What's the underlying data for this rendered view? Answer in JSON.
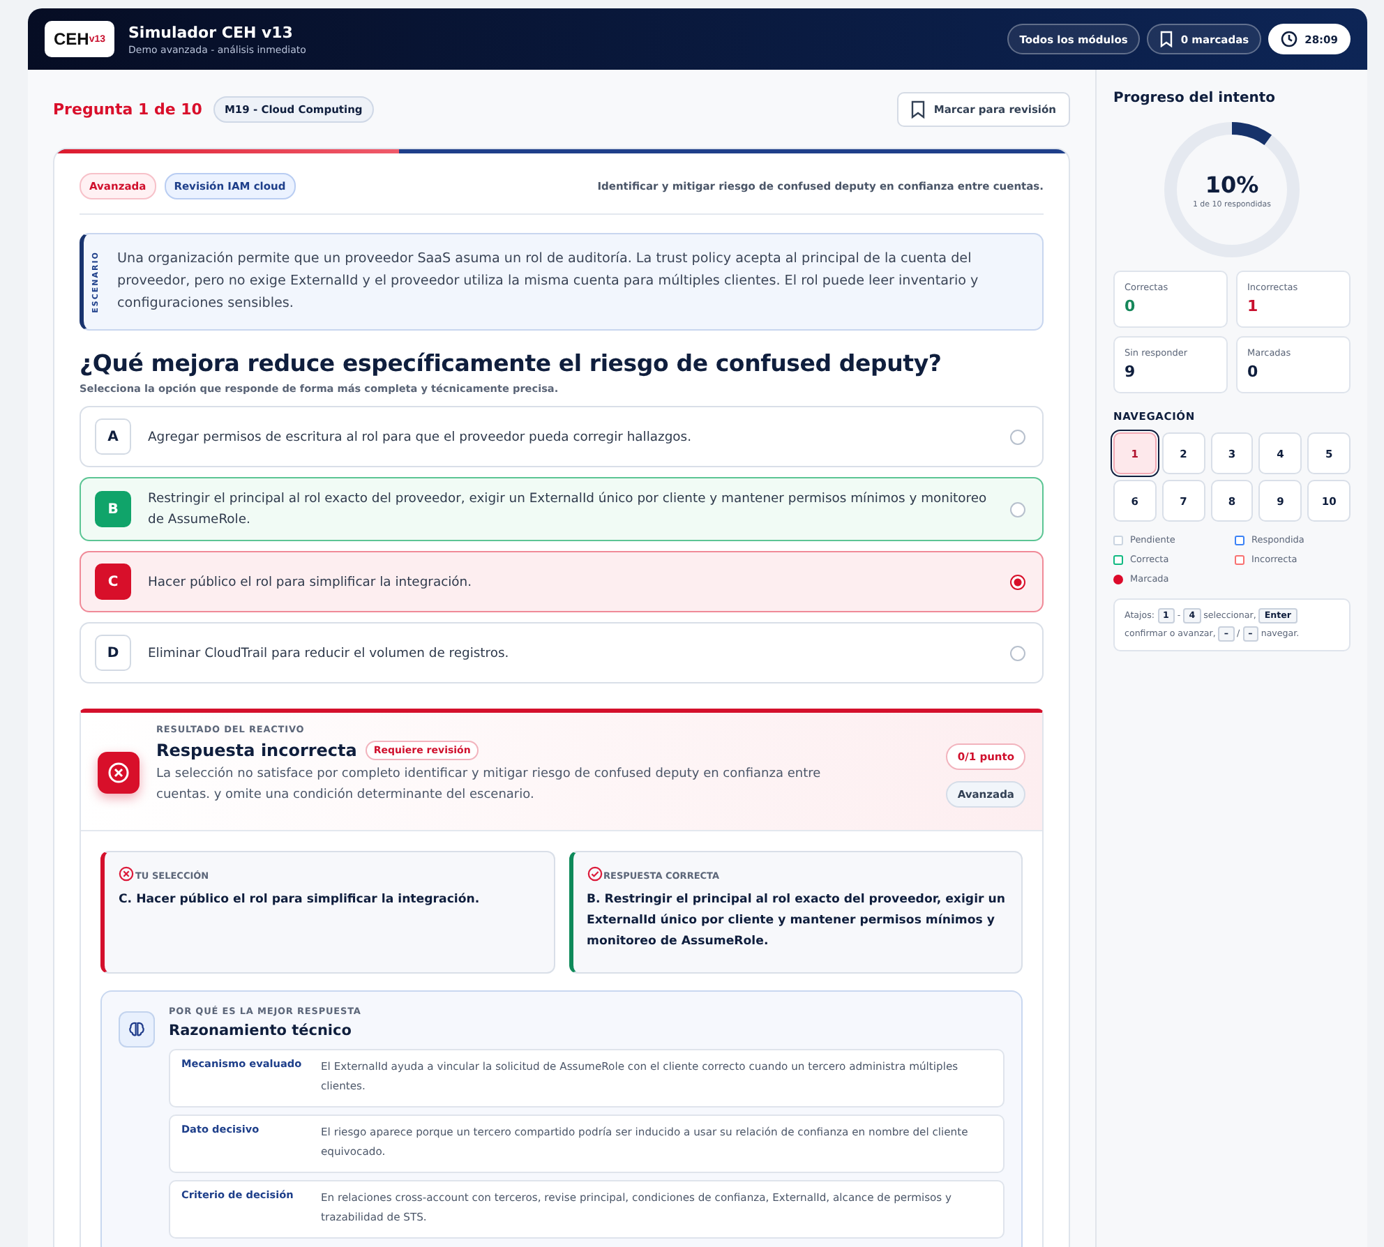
{
  "header": {
    "logo_main": "CEH",
    "logo_version": "v13",
    "title": "Simulador CEH v13",
    "subtitle": "Demo avanzada - análisis inmediato",
    "modules_button": "Todos los módulos",
    "marked_button": "0 marcadas",
    "timer": "28:09"
  },
  "question_bar": {
    "counter": "Pregunta 1 de 10",
    "module_tag": "M19 - Cloud Computing",
    "mark_button": "Marcar para revisión"
  },
  "question": {
    "level": 0.34,
    "tags": [
      {
        "label": "Avanzada",
        "kind": "danger"
      },
      {
        "label": "Revisión IAM cloud",
        "kind": "info"
      }
    ],
    "objective": "Identificar y mitigar riesgo de confused deputy en confianza entre cuentas.",
    "scenario_label": "ESCENARIO",
    "scenario": "Una organización permite que un proveedor SaaS asuma un rol de auditoría. La trust policy acepta al principal de la cuenta del proveedor, pero no exige ExternalId y el proveedor utiliza la misma cuenta para múltiples clientes. El rol puede leer inventario y configuraciones sensibles.",
    "prompt": "¿Qué mejora reduce específicamente el riesgo de confused deputy?",
    "hint": "Selecciona la opción que responde de forma más completa y técnicamente precisa.",
    "options": [
      {
        "letter": "A",
        "text": "Agregar permisos de escritura al rol para que el proveedor pueda corregir hallazgos.",
        "kind": "neutral",
        "selected": false
      },
      {
        "letter": "B",
        "text": "Restringir el principal al rol exacto del proveedor, exigir un ExternalId único por cliente y mantener permisos mínimos y monitoreo de AssumeRole.",
        "kind": "correct",
        "selected": false
      },
      {
        "letter": "C",
        "text": "Hacer público el rol para simplificar la integración.",
        "kind": "incorrect",
        "selected": true
      },
      {
        "letter": "D",
        "text": "Eliminar CloudTrail para reducir el volumen de registros.",
        "kind": "neutral",
        "selected": false
      }
    ]
  },
  "result": {
    "eyebrow": "RESULTADO DEL REACTIVO",
    "title": "Respuesta incorrecta",
    "badge": "Requiere revisión",
    "text": "La selección no satisface por completo identificar y mitigar riesgo de confused deputy en confianza entre cuentas. y omite una condición determinante del escenario.",
    "score": "0/1 punto",
    "difficulty": "Avanzada",
    "comparison": [
      {
        "kind": "wrong",
        "label": "TU SELECCIÓN",
        "text": "C. Hacer público el rol para simplificar la integración."
      },
      {
        "kind": "right",
        "label": "RESPUESTA CORRECTA",
        "text": "B. Restringir el principal al rol exacto del proveedor, exigir un ExternalId único por cliente y mantener permisos mínimos y monitoreo de AssumeRole."
      }
    ],
    "reasoning": {
      "eyebrow": "POR QUÉ ES LA MEJOR RESPUESTA",
      "title": "Razonamiento técnico",
      "rows": [
        {
          "label": "Mecanismo evaluado",
          "text": "El ExternalId ayuda a vincular la solicitud de AssumeRole con el cliente correcto cuando un tercero administra múltiples clientes."
        },
        {
          "label": "Dato decisivo",
          "text": "El riesgo aparece porque un tercero compartido podría ser inducido a usar su relación de confianza en nombre del cliente equivocado."
        },
        {
          "label": "Criterio de decisión",
          "text": "En relaciones cross-account con terceros, revise principal, condiciones de confianza, ExternalId, alcance de permisos y trazabilidad de STS."
        }
      ]
    }
  },
  "sidebar": {
    "title": "Progreso del intento",
    "percent": "10%",
    "level": 0.1,
    "answered": "1 de 10 respondidas",
    "stats": [
      {
        "label": "Correctas",
        "value": "0",
        "kind": "good"
      },
      {
        "label": "Incorrectas",
        "value": "1",
        "kind": "bad"
      },
      {
        "label": "Sin responder",
        "value": "9",
        "kind": "plain"
      },
      {
        "label": "Marcadas",
        "value": "0",
        "kind": "plain"
      }
    ],
    "nav_title": "NAVEGACIÓN",
    "nav": [
      {
        "label": "1",
        "selected": true,
        "kind": "incorrect"
      },
      {
        "label": "2",
        "selected": false,
        "kind": "pending"
      },
      {
        "label": "3",
        "selected": false,
        "kind": "pending"
      },
      {
        "label": "4",
        "selected": false,
        "kind": "pending"
      },
      {
        "label": "5",
        "selected": false,
        "kind": "pending"
      },
      {
        "label": "6",
        "selected": false,
        "kind": "pending"
      },
      {
        "label": "7",
        "selected": false,
        "kind": "pending"
      },
      {
        "label": "8",
        "selected": false,
        "kind": "pending"
      },
      {
        "label": "9",
        "selected": false,
        "kind": "pending"
      },
      {
        "label": "10",
        "selected": false,
        "kind": "pending"
      }
    ],
    "legend": [
      {
        "label": "Pendiente",
        "color": "#cbd5e1",
        "kind": "square"
      },
      {
        "label": "Respondida",
        "color": "#3b82f6",
        "kind": "square"
      },
      {
        "label": "Correcta",
        "color": "#10b981",
        "kind": "square"
      },
      {
        "label": "Incorrecta",
        "color": "#f87171",
        "kind": "square"
      },
      {
        "label": "Marcada",
        "color": "#dc0a2a",
        "kind": "dot"
      }
    ],
    "shortcuts": [
      {
        "kind": "text",
        "t": "Atajos:"
      },
      {
        "kind": "key",
        "t": "1"
      },
      {
        "kind": "text",
        "t": "-"
      },
      {
        "kind": "key",
        "t": "4"
      },
      {
        "kind": "text",
        "t": "seleccionar,"
      },
      {
        "kind": "key",
        "t": "Enter"
      },
      {
        "kind": "text",
        "t": "confirmar o avanzar,"
      },
      {
        "kind": "key",
        "t": "–"
      },
      {
        "kind": "text",
        "t": "/"
      },
      {
        "kind": "key",
        "t": "–"
      },
      {
        "kind": "text",
        "t": "navegar."
      }
    ]
  }
}
